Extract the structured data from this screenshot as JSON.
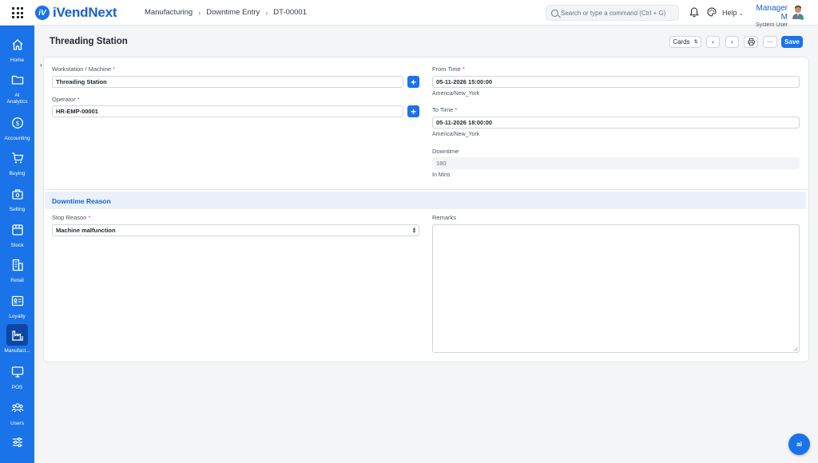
{
  "app": {
    "name": "iVendNext",
    "logo_letter": "iV"
  },
  "breadcrumb": {
    "items": [
      "Manufacturing",
      "Downtime Entry",
      "DT-00001"
    ]
  },
  "search": {
    "placeholder": "Search or type a command (Ctrl + G)"
  },
  "topbar": {
    "help_label": "Help",
    "user_name": "Manager M",
    "user_role": "System User"
  },
  "sidebar": {
    "items": [
      {
        "label": "Home",
        "icon": "home-icon"
      },
      {
        "label": "AI\nAnalytics",
        "icon": "folder-icon"
      },
      {
        "label": "Accounting",
        "icon": "dollar-icon"
      },
      {
        "label": "Buying",
        "icon": "cart-icon"
      },
      {
        "label": "Selling",
        "icon": "selling-icon"
      },
      {
        "label": "Stock",
        "icon": "box-icon"
      },
      {
        "label": "Retail",
        "icon": "retail-icon"
      },
      {
        "label": "Loyalty",
        "icon": "loyalty-icon"
      },
      {
        "label": "Manufact...",
        "icon": "factory-icon",
        "active": true
      },
      {
        "label": "POS",
        "icon": "monitor-icon"
      },
      {
        "label": "Users",
        "icon": "users-icon"
      },
      {
        "label": "",
        "icon": "settings-sliders-icon"
      }
    ]
  },
  "page": {
    "title": "Threading Station",
    "view_select": "Cards",
    "save_label": "Save",
    "more_label": "···"
  },
  "form": {
    "workstation": {
      "label": "Workstation / Machine",
      "value": "Threading Station"
    },
    "operator": {
      "label": "Operator",
      "value": "HR-EMP-00001"
    },
    "from_time": {
      "label": "From Time",
      "value": "05-11-2026 15:00:00",
      "tz": "America/New_York"
    },
    "to_time": {
      "label": "To Time",
      "value": "05-11-2026 18:00:00",
      "tz": "America/New_York"
    },
    "downtime": {
      "label": "Downtime",
      "value": "180",
      "hint": "In Mins"
    },
    "section_title": "Downtime Reason",
    "stop_reason": {
      "label": "Stop Reason",
      "value": "Machine malfunction"
    },
    "remarks": {
      "label": "Remarks",
      "value": ""
    }
  },
  "fab": {
    "label": "ai"
  },
  "colors": {
    "brand": "#1a73e8",
    "required": "#e24c4c",
    "section_bg": "#eaf1fb"
  }
}
